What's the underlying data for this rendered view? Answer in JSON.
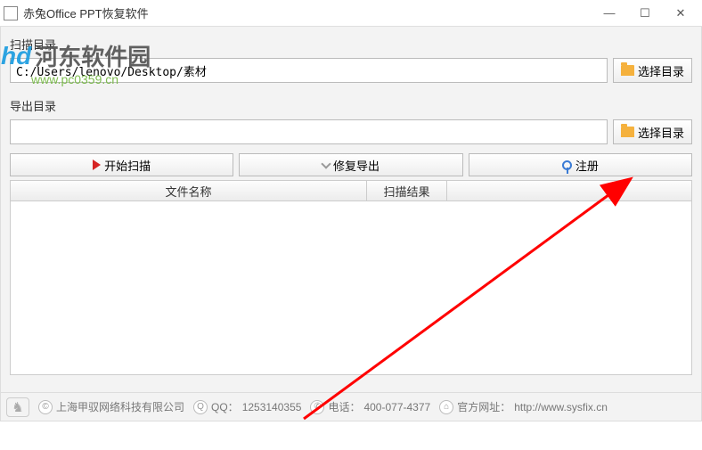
{
  "window": {
    "title": "赤兔Office PPT恢复软件"
  },
  "watermark": {
    "logo_text": "河东软件园",
    "url": "www.pc0359.cn"
  },
  "scan": {
    "label": "扫描目录",
    "path": "C:/Users/lenovo/Desktop/素材",
    "browse": "选择目录"
  },
  "export": {
    "label": "导出目录",
    "path": "",
    "browse": "选择目录"
  },
  "actions": {
    "start_scan": "开始扫描",
    "repair_export": "修复导出",
    "register": "注册"
  },
  "table": {
    "col_filename": "文件名称",
    "col_scanresult": "扫描结果"
  },
  "status": {
    "company": "上海甲驭网络科技有限公司",
    "qq_label": "QQ：",
    "qq": "1253140355",
    "phone_label": "电话：",
    "phone": "400-077-4377",
    "site_label": "官方网址：",
    "site": "http://www.sysfix.cn"
  }
}
